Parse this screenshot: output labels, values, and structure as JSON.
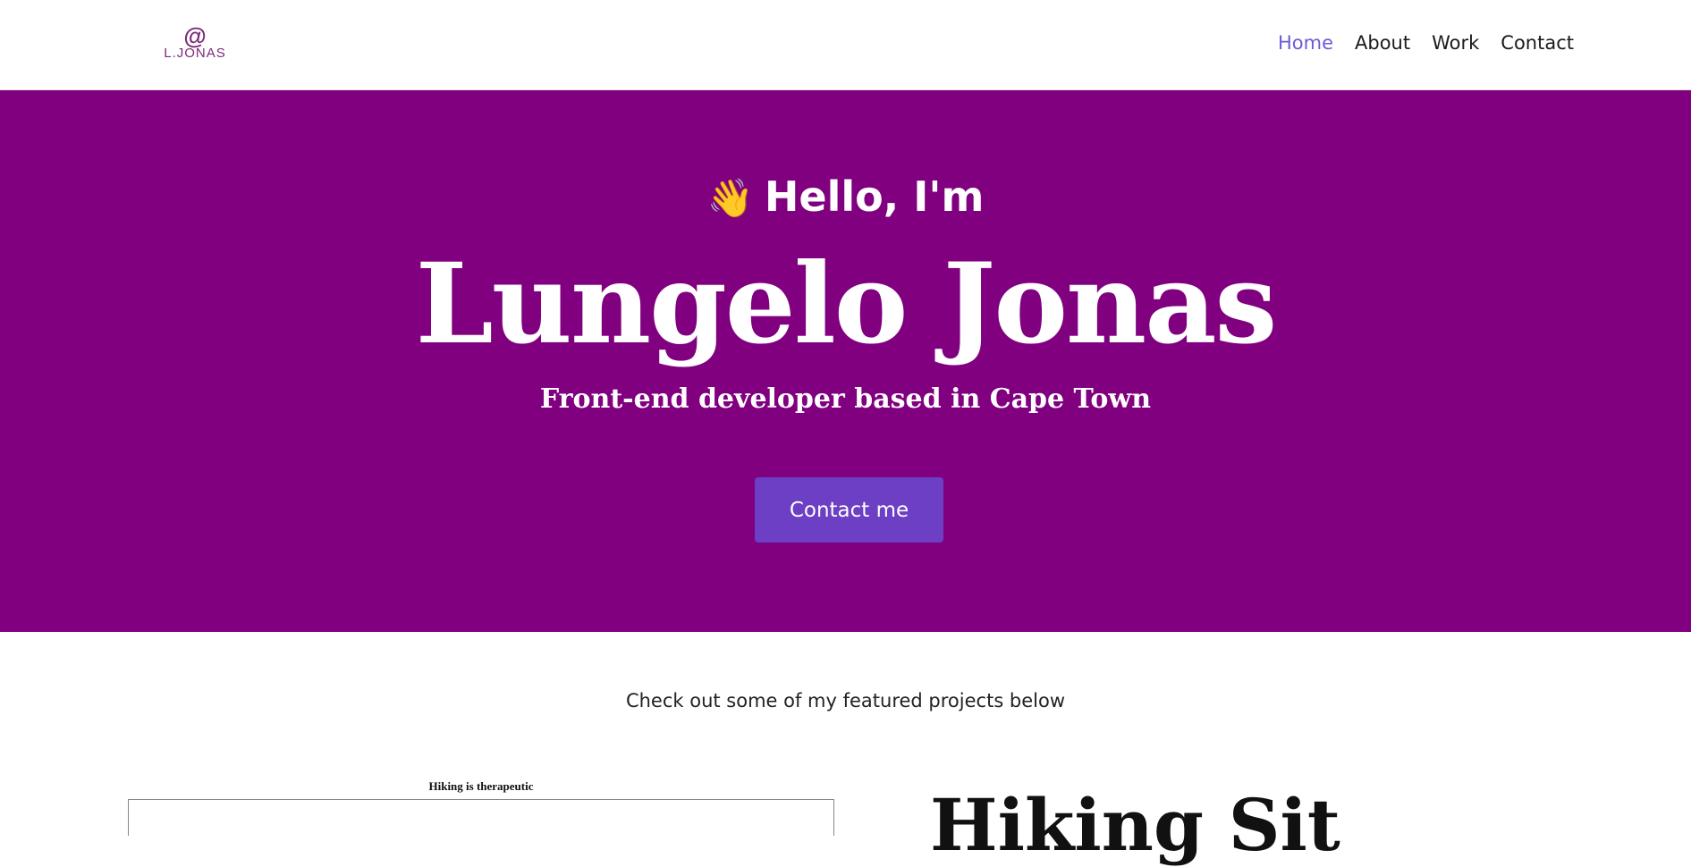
{
  "nav": {
    "logo": {
      "symbol": "@",
      "text": "L.JONAS"
    },
    "links": [
      {
        "label": "Home",
        "active": true
      },
      {
        "label": "About",
        "active": false
      },
      {
        "label": "Work",
        "active": false
      },
      {
        "label": "Contact",
        "active": false
      }
    ]
  },
  "hero": {
    "wave_icon": "👋",
    "greeting": "Hello, I'm",
    "name": "Lungelo Jonas",
    "tagline": "Front-end developer based in Cape Town",
    "cta_label": "Contact me"
  },
  "projects": {
    "intro": "Check out some of my featured projects below",
    "first_preview_caption": "Hiking is therapeutic",
    "first_title": "Hiking Sit"
  },
  "colors": {
    "hero_bg": "#800080",
    "button_bg": "#6c3fc4",
    "nav_active": "#6b5bd9",
    "logo": "#7a2a7a"
  }
}
